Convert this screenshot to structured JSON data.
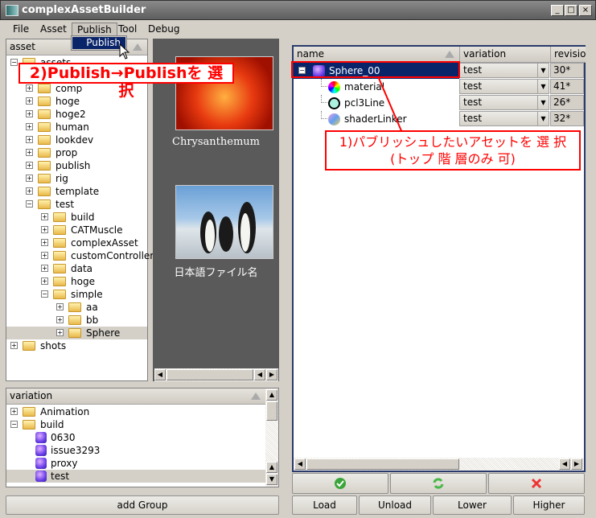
{
  "window": {
    "title": "complexAssetBuilder",
    "controls": [
      "_",
      "□",
      "×"
    ]
  },
  "menubar": {
    "items": [
      "File",
      "Asset",
      "Publish",
      "Tool",
      "Debug"
    ],
    "open_menu": "Publish",
    "dropdown_items": [
      "Publish"
    ]
  },
  "asset_panel": {
    "header": "asset",
    "tree": [
      {
        "label": "assets",
        "depth": 0,
        "expander": "−",
        "type": "folder"
      },
      {
        "label": "comp",
        "depth": 1,
        "expander": "+",
        "type": "folder"
      },
      {
        "label": "hoge",
        "depth": 1,
        "expander": "+",
        "type": "folder"
      },
      {
        "label": "hoge2",
        "depth": 1,
        "expander": "+",
        "type": "folder"
      },
      {
        "label": "human",
        "depth": 1,
        "expander": "+",
        "type": "folder"
      },
      {
        "label": "lookdev",
        "depth": 1,
        "expander": "+",
        "type": "folder"
      },
      {
        "label": "prop",
        "depth": 1,
        "expander": "+",
        "type": "folder"
      },
      {
        "label": "publish",
        "depth": 1,
        "expander": "+",
        "type": "folder"
      },
      {
        "label": "rig",
        "depth": 1,
        "expander": "+",
        "type": "folder"
      },
      {
        "label": "template",
        "depth": 1,
        "expander": "+",
        "type": "folder"
      },
      {
        "label": "test",
        "depth": 1,
        "expander": "−",
        "type": "folder"
      },
      {
        "label": "build",
        "depth": 2,
        "expander": "+",
        "type": "folder"
      },
      {
        "label": "CATMuscle",
        "depth": 2,
        "expander": "+",
        "type": "folder"
      },
      {
        "label": "complexAsset",
        "depth": 2,
        "expander": "+",
        "type": "folder"
      },
      {
        "label": "customController",
        "depth": 2,
        "expander": "+",
        "type": "folder"
      },
      {
        "label": "data",
        "depth": 2,
        "expander": "+",
        "type": "folder"
      },
      {
        "label": "hoge",
        "depth": 2,
        "expander": "+",
        "type": "folder"
      },
      {
        "label": "simple",
        "depth": 2,
        "expander": "−",
        "type": "folder"
      },
      {
        "label": "aa",
        "depth": 3,
        "expander": "+",
        "type": "folder"
      },
      {
        "label": "bb",
        "depth": 3,
        "expander": "+",
        "type": "folder"
      },
      {
        "label": "Sphere",
        "depth": 3,
        "expander": "+",
        "type": "folder",
        "selected": true
      },
      {
        "label": "shots",
        "depth": 0,
        "expander": "+",
        "type": "folder"
      }
    ]
  },
  "thumbnails": [
    {
      "label": "Chrysanthemum"
    },
    {
      "label": "日本語ファイル名"
    }
  ],
  "variation_panel": {
    "header": "variation",
    "tree": [
      {
        "label": "Animation",
        "depth": 0,
        "expander": "+",
        "type": "folder"
      },
      {
        "label": "build",
        "depth": 0,
        "expander": "−",
        "type": "folder"
      },
      {
        "label": "0630",
        "depth": 1,
        "type": "asset"
      },
      {
        "label": "issue3293",
        "depth": 1,
        "type": "asset"
      },
      {
        "label": "proxy",
        "depth": 1,
        "type": "asset"
      },
      {
        "label": "test",
        "depth": 1,
        "type": "asset",
        "selected": true
      }
    ],
    "add_group": "add Group"
  },
  "asset_table": {
    "columns": [
      "name",
      "variation",
      "revision"
    ],
    "rows": [
      {
        "name": "Sphere_00",
        "variation": "test",
        "revision": "30*",
        "selected": true,
        "icon": "cube-icon"
      },
      {
        "name": "material",
        "variation": "test",
        "revision": "41*",
        "icon": "color-sphere-icon"
      },
      {
        "name": "pcl3Line",
        "variation": "test",
        "revision": "26*",
        "icon": "circle-icon"
      },
      {
        "name": "shaderLinker",
        "variation": "test",
        "revision": "32*",
        "icon": "shader-sphere-icon"
      }
    ]
  },
  "actions": {
    "icons": [
      "check-icon",
      "refresh-icon",
      "delete-icon"
    ],
    "colors": {
      "check": "#3aa53a",
      "refresh": "#4ab84a",
      "delete": "#ee3333"
    },
    "buttons": [
      "Load",
      "Unload",
      "Lower",
      "Higher"
    ]
  },
  "annotations": {
    "step2": "2)Publish→Publishを 選 択",
    "step1_line1": "1)パブリッシュしたいアセットを 選 択",
    "step1_line2": "(トップ 階 層のみ 可)",
    "color": "#ff0000"
  }
}
